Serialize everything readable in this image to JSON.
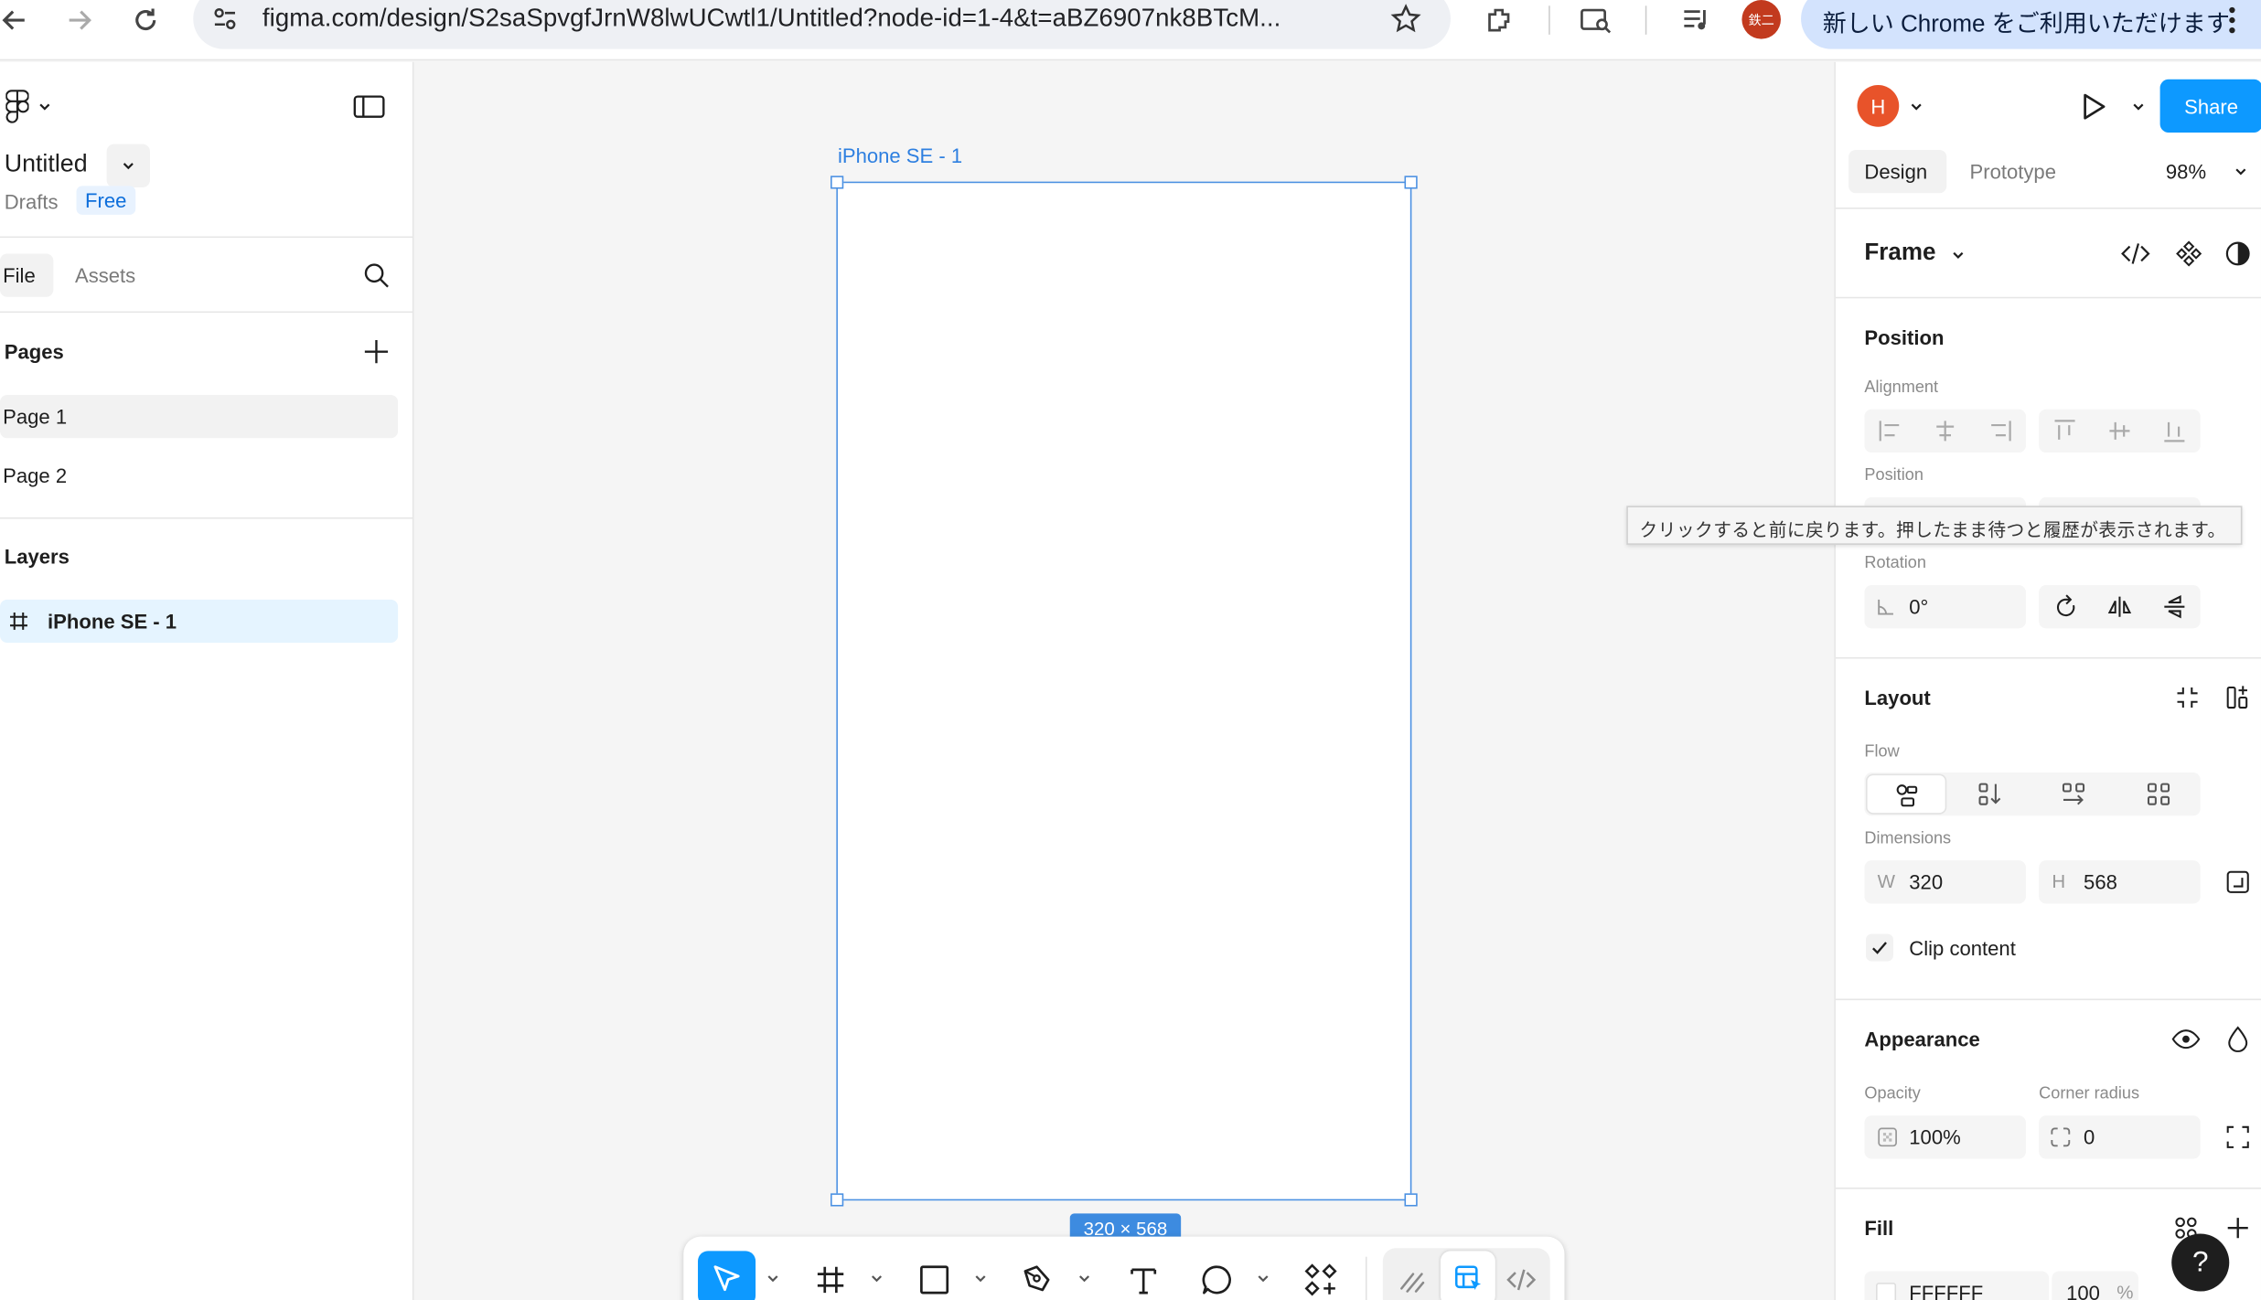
{
  "browser": {
    "url": "figma.com/design/S2saSpvgfJrnW8lwUCwtl1/Untitled?node-id=1-4&t=aBZ6907nk8BTcM...",
    "profile_label": "鉄二",
    "update_pill": "新しい Chrome をご利用いただけます"
  },
  "file": {
    "name": "Untitled",
    "location": "Drafts",
    "plan": "Free"
  },
  "left_tabs": {
    "file": "File",
    "assets": "Assets"
  },
  "pages": {
    "title": "Pages",
    "items": [
      {
        "label": "Page 1",
        "selected": true
      },
      {
        "label": "Page 2",
        "selected": false
      }
    ]
  },
  "layers": {
    "title": "Layers",
    "items": [
      {
        "label": "iPhone SE - 1",
        "icon": "frame-hash-icon"
      }
    ]
  },
  "canvas": {
    "frame_name": "iPhone SE - 1",
    "size_badge": "320 × 568"
  },
  "header_right": {
    "avatar_letter": "H",
    "share_label": "Share",
    "tabs": {
      "design": "Design",
      "prototype": "Prototype"
    },
    "zoom": "98%"
  },
  "inspector": {
    "frame_label": "Frame",
    "position_section": "Position",
    "alignment_label": "Alignment",
    "position_label": "Position",
    "rotation_label": "Rotation",
    "rotation_value": "0°",
    "layout_section": "Layout",
    "flow_label": "Flow",
    "dimensions_label": "Dimensions",
    "width_label": "W",
    "width_value": "320",
    "height_label": "H",
    "height_value": "568",
    "clip_content_label": "Clip content",
    "clip_content_checked": true,
    "appearance_section": "Appearance",
    "opacity_label": "Opacity",
    "opacity_value": "100%",
    "corner_radius_label": "Corner radius",
    "corner_radius_value": "0",
    "fill_section": "Fill",
    "fill_hex": "FFFFFF",
    "fill_opacity": "100",
    "fill_opacity_unit": "%"
  },
  "tooltip": "クリックすると前に戻ります。押したまま待つと履歴が表示されます。",
  "help_label": "?",
  "colors": {
    "accent": "#0d99ff",
    "selection": "#4a90e2",
    "layer_selected_bg": "#e5f4ff",
    "profile_avatar": "#e8532a"
  }
}
